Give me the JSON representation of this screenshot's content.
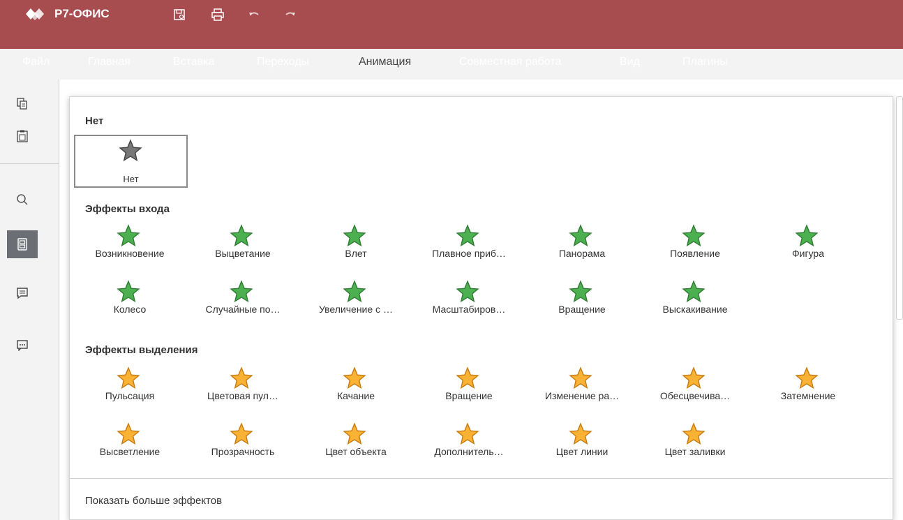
{
  "app": {
    "brand": "Р7-ОФИС"
  },
  "colors": {
    "header": "#a84d4f",
    "entrance": "#4caf50",
    "emphasis": "#f9b234"
  },
  "tabs": [
    "Файл",
    "Главная",
    "Вставка",
    "Переходы",
    "Анимация",
    "Совместная работа",
    "Вид",
    "Плагины"
  ],
  "active_tab": "Анимация",
  "panel": {
    "none_group": "Нет",
    "none_item": "Нет",
    "entrance_group": "Эффекты входа",
    "entrance": [
      {
        "label": "Возникновение",
        "icon": "star-burst-icon"
      },
      {
        "label": "Выцветание",
        "icon": "star-fade-icon"
      },
      {
        "label": "Влет",
        "icon": "star-fly-in-icon"
      },
      {
        "label": "Плавное приб…",
        "icon": "star-float-in-icon"
      },
      {
        "label": "Панорама",
        "icon": "star-split-icon"
      },
      {
        "label": "Появление",
        "icon": "star-wipe-icon"
      },
      {
        "label": "Фигура",
        "icon": "star-shape-icon"
      },
      {
        "label": "Колесо",
        "icon": "star-wheel-icon"
      },
      {
        "label": "Случайные по…",
        "icon": "star-random-bars-icon"
      },
      {
        "label": "Увеличение с …",
        "icon": "star-grow-turn-icon"
      },
      {
        "label": "Масштабиров…",
        "icon": "star-zoom-icon"
      },
      {
        "label": "Вращение",
        "icon": "star-swivel-icon"
      },
      {
        "label": "Выскакивание",
        "icon": "star-bounce-icon"
      }
    ],
    "emphasis_group": "Эффекты выделения",
    "emphasis": [
      {
        "label": "Пульсация",
        "icon": "star-pulse-icon"
      },
      {
        "label": "Цветовая пул…",
        "icon": "star-color-pulse-icon"
      },
      {
        "label": "Качание",
        "icon": "star-teeter-icon"
      },
      {
        "label": "Вращение",
        "icon": "star-spin-icon"
      },
      {
        "label": "Изменение ра…",
        "icon": "star-grow-shrink-icon"
      },
      {
        "label": "Обесцвечива…",
        "icon": "star-desaturate-icon"
      },
      {
        "label": "Затемнение",
        "icon": "star-darken-icon"
      },
      {
        "label": "Высветление",
        "icon": "star-lighten-icon"
      },
      {
        "label": "Прозрачность",
        "icon": "star-transparency-icon"
      },
      {
        "label": "Цвет объекта",
        "icon": "star-object-color-icon"
      },
      {
        "label": "Дополнитель…",
        "icon": "star-complementary-icon"
      },
      {
        "label": "Цвет линии",
        "icon": "star-line-color-icon"
      },
      {
        "label": "Цвет заливки",
        "icon": "star-fill-color-icon"
      }
    ],
    "more_effects": "Показать больше эффектов"
  }
}
